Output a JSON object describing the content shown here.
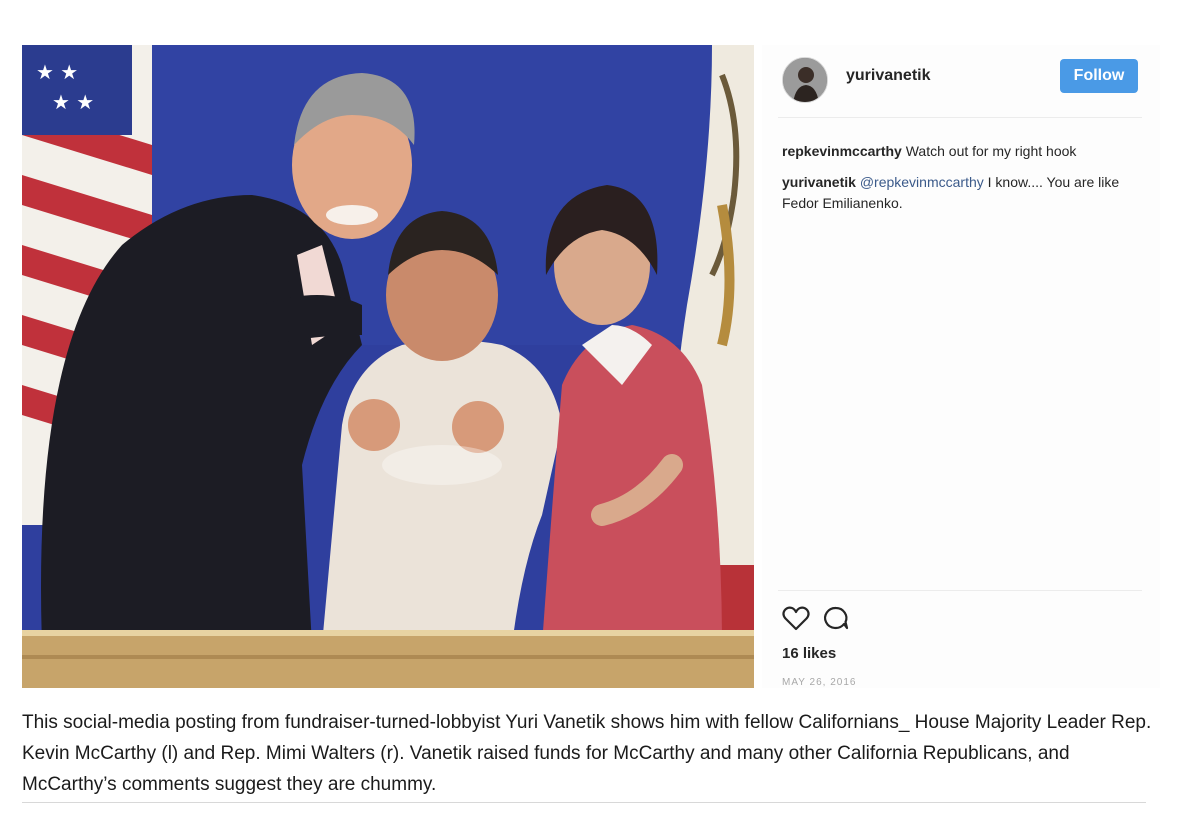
{
  "post": {
    "photo_alt": "Three people posing at a fundraiser photo booth with US and California flags",
    "author": {
      "username": "yurivanetik",
      "follow_label": "Follow"
    },
    "comments": [
      {
        "user": "repkevinmccarthy",
        "mention": "",
        "text": " Watch out for my right hook"
      },
      {
        "user": "yurivanetik",
        "mention": " @repkevinmccarthy",
        "text": " I know.... You are like Fedor Emilianenko."
      }
    ],
    "likes": "16 likes",
    "date": "MAY 26, 2016",
    "icons": [
      "heart-icon",
      "comment-icon",
      "avatar-image"
    ]
  },
  "caption": "This social-media posting from fundraiser-turned-lobbyist Yuri Vanetik shows him with fellow Californians_ House Majority Leader Rep. Kevin McCarthy (l) and Rep. Mimi Walters (r). Vanetik raised funds for McCarthy and many other California Republicans, and McCarthy’s comments suggest they are chummy.",
  "colors": {
    "follow_button": "#4a9ae6",
    "backdrop": "#2d3fa0"
  }
}
